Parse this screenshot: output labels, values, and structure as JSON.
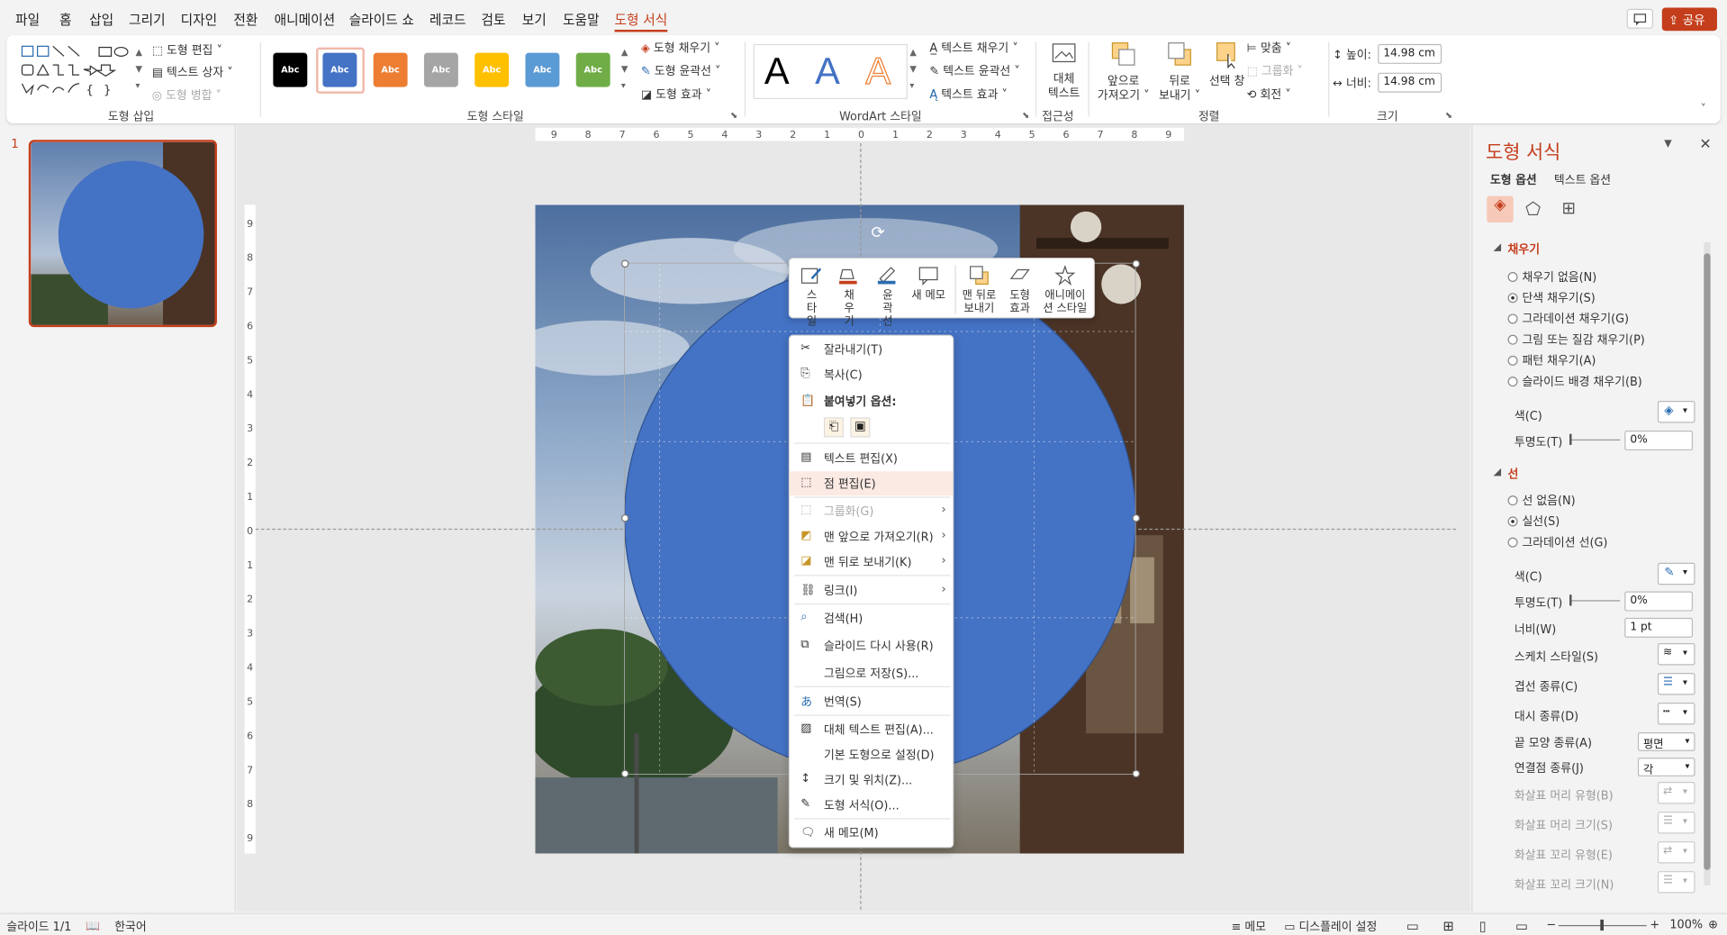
{
  "tabs": [
    "파일",
    "홈",
    "삽입",
    "그리기",
    "디자인",
    "전환",
    "애니메이션",
    "슬라이드 쇼",
    "레코드",
    "검토",
    "보기",
    "도움말",
    "도형 서식"
  ],
  "share_label": "공유",
  "ribbon": {
    "shape_edit": "도형 편집",
    "text_box": "텍스트 상자",
    "shape_merge": "도형 병합",
    "group_insert": "도형 삽입",
    "swatch_text": "Abc",
    "shape_fill": "도형 채우기",
    "shape_outline": "도형 윤곽선",
    "shape_effect": "도형 효과",
    "group_style": "도형 스타일",
    "wordart_letter": "A",
    "text_fill": "텍스트 채우기",
    "text_outline": "텍스트 윤곽선",
    "text_effect": "텍스트 효과",
    "group_wordart": "WordArt 스타일",
    "alt_text_1": "대체",
    "alt_text_2": "텍스트",
    "group_access": "접근성",
    "bring_front_1": "앞으로",
    "bring_front_2": "가져오기",
    "send_back_1": "뒤로",
    "send_back_2": "보내기",
    "select_pane": "선택 창",
    "align": "맞춤",
    "group": "그룹화",
    "rotate": "회전",
    "group_arrange": "정렬",
    "height_label": "높이:",
    "height_value": "14.98 cm",
    "width_label": "너비:",
    "width_value": "14.98 cm",
    "group_size": "크기",
    "colors": {
      "black": "#000000",
      "blue": "#4472c4",
      "orange": "#ed7d31",
      "gray": "#a5a5a5",
      "gold": "#ffc000",
      "lightblue": "#5b9bd5",
      "green": "#70ad47",
      "accent": "#c43e1c"
    }
  },
  "slide_number": "1",
  "ruler_h": [
    "9",
    "8",
    "7",
    "6",
    "5",
    "4",
    "3",
    "2",
    "1",
    "0",
    "1",
    "2",
    "3",
    "4",
    "5",
    "6",
    "7",
    "8",
    "9"
  ],
  "ruler_v": [
    "9",
    "8",
    "7",
    "6",
    "5",
    "4",
    "3",
    "2",
    "1",
    "0",
    "1",
    "2",
    "3",
    "4",
    "5",
    "6",
    "7",
    "8",
    "9"
  ],
  "mini_toolbar": {
    "style": "스타일",
    "fill": "채우기",
    "outline": "윤곽선",
    "new_memo": "새 메모",
    "send_back": "맨 뒤로 보내기",
    "effect": "도형 효과",
    "anim": "애니메이션 스타일"
  },
  "context_menu": {
    "cut": "잘라내기(T)",
    "copy": "복사(C)",
    "paste_options": "붙여넣기 옵션:",
    "edit_text": "텍스트 편집(X)",
    "edit_points": "점 편집(E)",
    "group": "그룹화(G)",
    "bring_front": "맨 앞으로 가져오기(R)",
    "send_back": "맨 뒤로 보내기(K)",
    "link": "링크(I)",
    "search": "검색(H)",
    "reuse_slides": "슬라이드 다시 사용(R)",
    "save_as_picture": "그림으로 저장(S)...",
    "translate": "번역(S)",
    "edit_alt_text": "대체 텍스트 편집(A)...",
    "set_default": "기본 도형으로 설정(D)",
    "size_position": "크기 및 위치(Z)...",
    "format_shape": "도형 서식(O)...",
    "new_memo": "새 메모(M)"
  },
  "format_pane": {
    "title": "도형 서식",
    "tab_shape": "도형 옵션",
    "tab_text": "텍스트 옵션",
    "fill_section": "채우기",
    "fill_options": [
      "채우기 없음(N)",
      "단색 채우기(S)",
      "그라데이션 채우기(G)",
      "그림 또는 질감 채우기(P)",
      "패턴 채우기(A)",
      "슬라이드 배경 채우기(B)"
    ],
    "fill_color_label": "색(C)",
    "fill_transparency_label": "투명도(T)",
    "fill_transparency_value": "0%",
    "line_section": "선",
    "line_options": [
      "선 없음(N)",
      "실선(S)",
      "그라데이션 선(G)"
    ],
    "line_color_label": "색(C)",
    "line_transparency_label": "투명도(T)",
    "line_transparency_value": "0%",
    "width_label": "너비(W)",
    "width_value": "1 pt",
    "sketch_label": "스케치 스타일(S)",
    "compound_label": "겹선 종류(C)",
    "dash_label": "대시 종류(D)",
    "cap_label": "끝 모양 종류(A)",
    "cap_value": "평면",
    "join_label": "연결점 종류(J)",
    "join_value": "각",
    "begin_arrow_type": "화살표 머리 유형(B)",
    "begin_arrow_size": "화살표 머리 크기(S)",
    "end_arrow_type": "화살표 꼬리 유형(E)",
    "end_arrow_size": "화살표 꼬리 크기(N)"
  },
  "status": {
    "slide": "슬라이드 1/1",
    "language": "한국어",
    "notes": "메모",
    "display": "디스플레이 설정",
    "zoom": "100%"
  }
}
